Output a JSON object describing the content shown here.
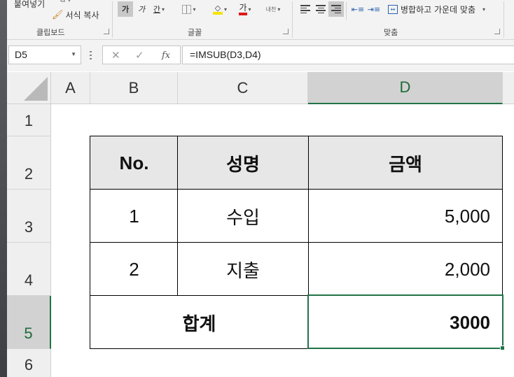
{
  "ribbon": {
    "clipboard": {
      "paste_label": "붙여넣기",
      "format_painter_label": "서식 복사",
      "group_label": "클립보드"
    },
    "font": {
      "bold_label": "가",
      "italic_label": "가",
      "underline_label": "간",
      "font_color_label": "가",
      "phonetic_label": "내천",
      "group_label": "글꼴"
    },
    "alignment": {
      "merge_center_label": "병합하고 가운데 맞춤",
      "group_label": "맞춤"
    }
  },
  "formula_bar": {
    "name_box": "D5",
    "cancel_icon": "✕",
    "enter_icon": "✓",
    "fx_label": "fx",
    "formula": "=IMSUB(D3,D4)"
  },
  "sheet": {
    "columns": [
      "A",
      "B",
      "C",
      "D"
    ],
    "rows": [
      "1",
      "2",
      "3",
      "4",
      "5",
      "6"
    ],
    "selected_cell": "D5",
    "table": {
      "headers": [
        "No.",
        "성명",
        "금액"
      ],
      "rows": [
        {
          "no": "1",
          "name": "수입",
          "amount": "5,000"
        },
        {
          "no": "2",
          "name": "지출",
          "amount": "2,000"
        }
      ],
      "total_label": "합계",
      "total_value": "3000"
    }
  },
  "colors": {
    "selection": "#217346",
    "header_fill": "#e7e7e7",
    "ribbon_bg": "#f3f3f3"
  }
}
